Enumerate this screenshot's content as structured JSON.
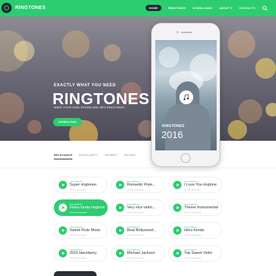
{
  "nav": {
    "brand": "RINGTONES",
    "items": [
      {
        "label": "HOME",
        "active": true
      },
      {
        "label": "RINGTONES",
        "active": false
      },
      {
        "label": "DOWNLOADS",
        "active": false
      },
      {
        "label": "ABOUT ▾",
        "active": false
      },
      {
        "label": "CONTACTS",
        "active": false
      }
    ],
    "search_icon": "search-icon"
  },
  "hero": {
    "subtitle": "EXACTLY WHAT YOU NEED",
    "title": "RINGTONES",
    "description": "MAKE YOUR OWN IPHONE AND MP3 RINGTONES",
    "button": "DOWNLOAD"
  },
  "phone": {
    "label": "RINGTONES",
    "year": "2016",
    "icon": "music-note-icon"
  },
  "tabs": [
    "RELEVANCE",
    "POPULARITY",
    "NEWEST",
    "RATING"
  ],
  "tracks": [
    {
      "category": "Sound Effects",
      "title": "Super ringtones",
      "downloads": "10 270 downloads",
      "active": false
    },
    {
      "category": "Sound Effects",
      "title": "Romantic Flute...",
      "downloads": "10 270 downloads",
      "active": false
    },
    {
      "category": "Sound Effects",
      "title": "I Love You ringtone",
      "downloads": "10 270 downloads",
      "active": false
    },
    {
      "category": "Sound Effects",
      "title": "Nokia tunda ringtone",
      "downloads": "10 270 downloads",
      "active": true
    },
    {
      "category": "Sound Effects",
      "title": "Very nice violin...",
      "downloads": "10 270 downloads",
      "active": false
    },
    {
      "category": "Sound Effects",
      "title": "Theme Instrumental",
      "downloads": "10 270 downloads",
      "active": false
    },
    {
      "category": "Sound Effects",
      "title": "Sweet Flute Music",
      "downloads": "10 270 downloads",
      "active": false
    },
    {
      "category": "Sound Effects",
      "title": "Beat Bollywood...",
      "downloads": "10 270 downloads",
      "active": false
    },
    {
      "category": "Sound Effects",
      "title": "Hero honda",
      "downloads": "10 270 downloads",
      "active": false
    },
    {
      "category": "Sound Effects",
      "title": "2015 blackberry",
      "downloads": "10 270 downloads",
      "active": false
    },
    {
      "category": "Sound Effects",
      "title": "Michael Jackson",
      "downloads": "10 270 downloads",
      "active": false
    },
    {
      "category": "Sound Effects",
      "title": "Top Sweet Violin",
      "downloads": "10 270 downloads",
      "active": false
    }
  ],
  "colors": {
    "accent": "#2ecc71",
    "dark": "#1e2a36",
    "text": "#2b2f33"
  }
}
